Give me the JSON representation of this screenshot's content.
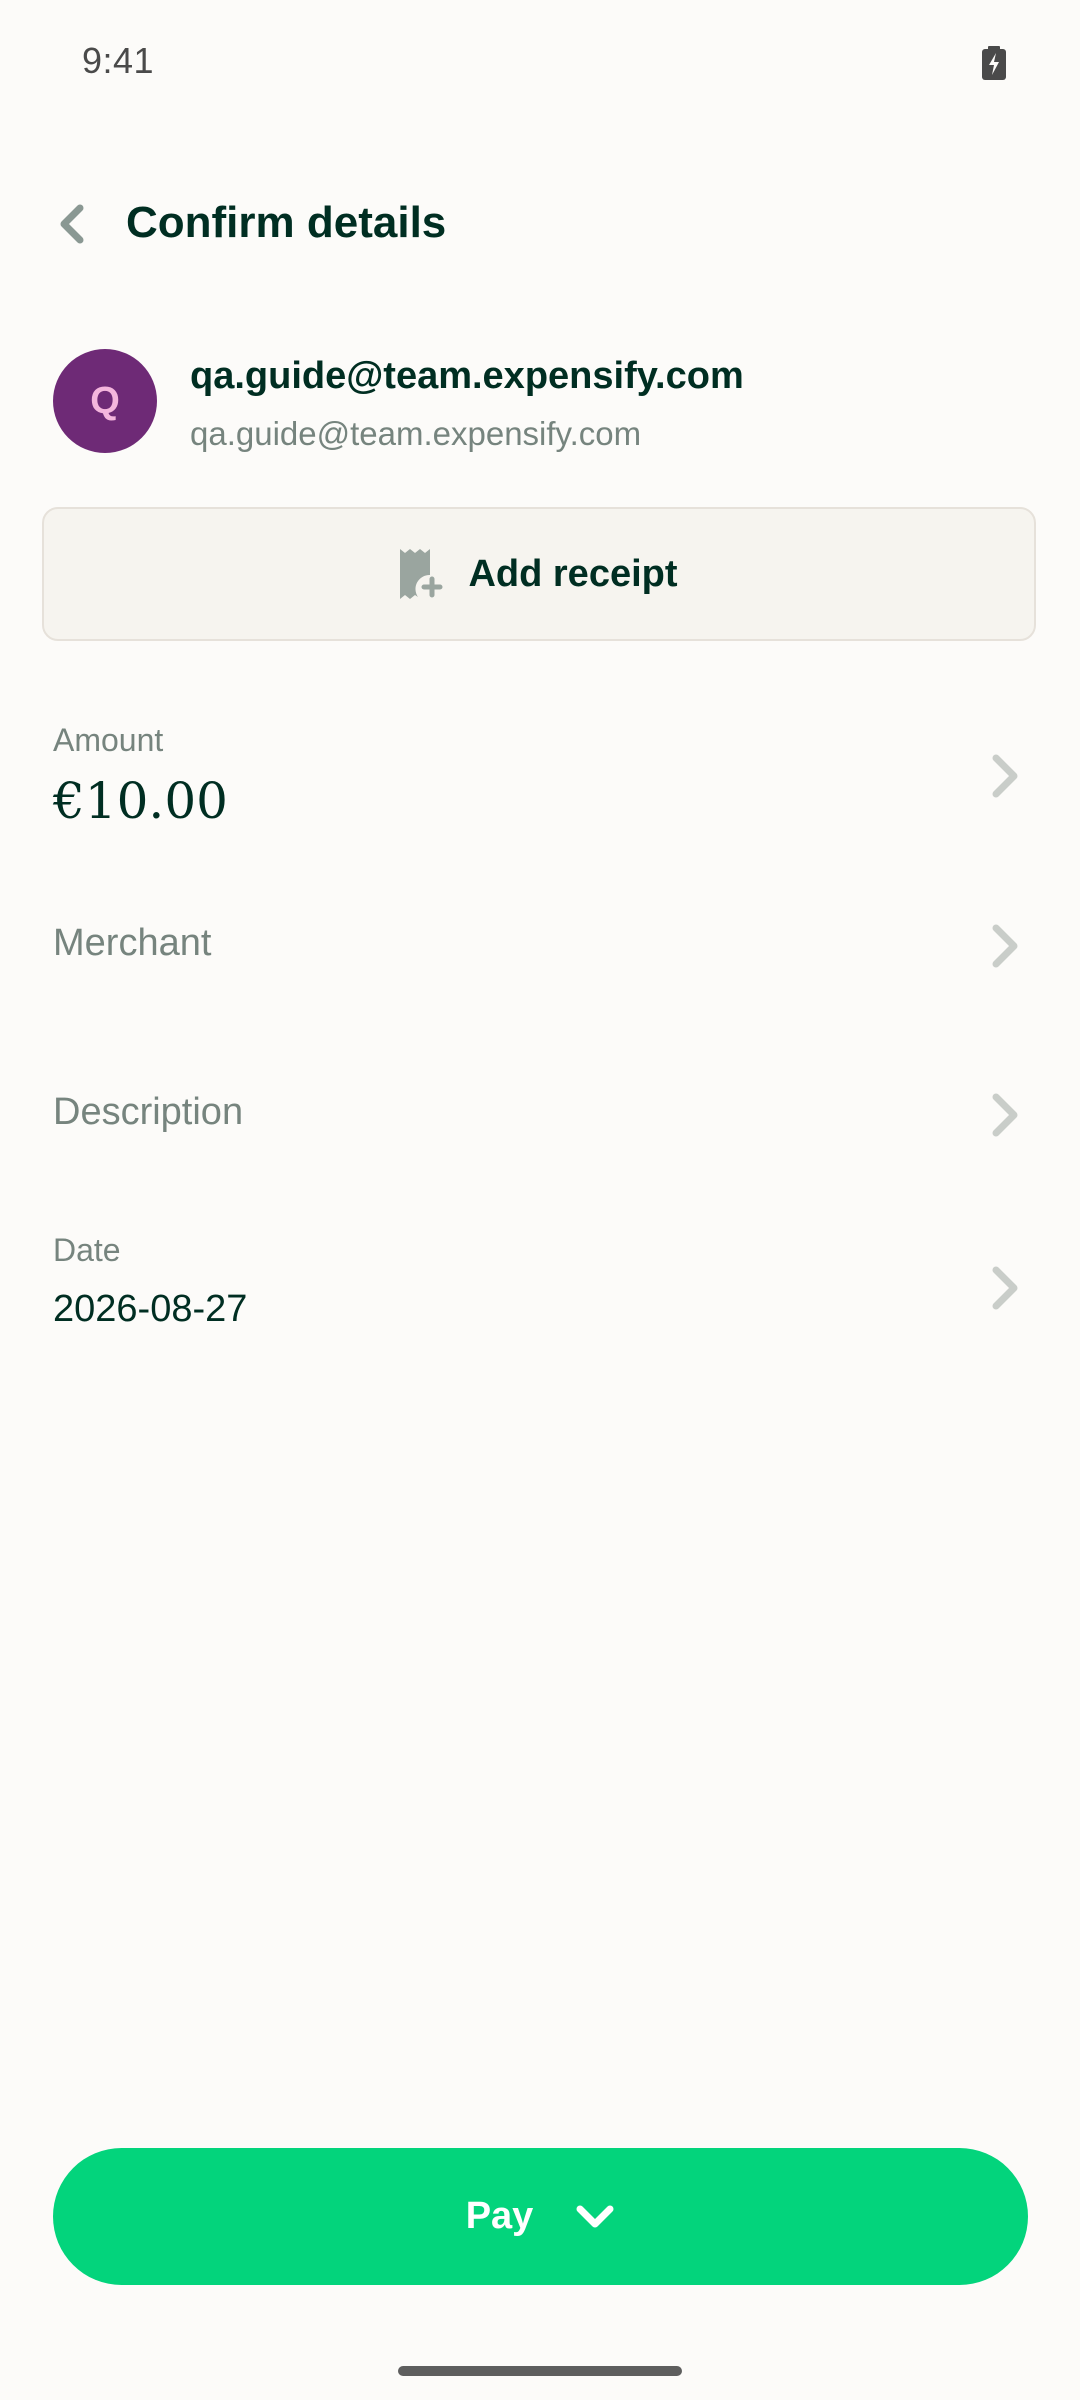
{
  "status_bar": {
    "time": "9:41"
  },
  "header": {
    "title": "Confirm details"
  },
  "participant": {
    "avatar_letter": "Q",
    "name": "qa.guide@team.expensify.com",
    "email": "qa.guide@team.expensify.com"
  },
  "add_receipt": {
    "label": "Add receipt"
  },
  "fields": {
    "amount": {
      "label": "Amount",
      "value": "€10.00"
    },
    "merchant": {
      "placeholder": "Merchant"
    },
    "description": {
      "placeholder": "Description"
    },
    "date": {
      "label": "Date",
      "value": "2026-08-27"
    }
  },
  "footer": {
    "pay_label": "Pay"
  },
  "colors": {
    "accent": "#03D47C",
    "text_primary": "#002E22",
    "text_secondary": "#76847E",
    "avatar_bg": "#6E2A76"
  },
  "icons": [
    "battery-icon",
    "back-arrow-icon",
    "receipt-add-icon",
    "chevron-right-icon",
    "chevron-down-icon"
  ]
}
